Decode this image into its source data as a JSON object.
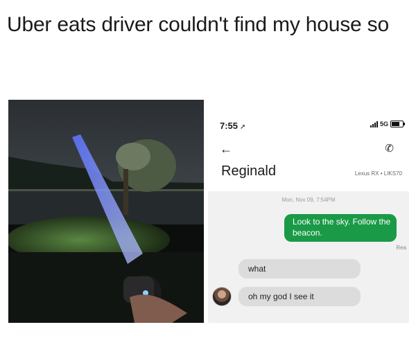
{
  "meme": {
    "caption": "Uber eats driver couldn't find my house so"
  },
  "photo": {
    "icon": "flashlight-beam-photo"
  },
  "phone": {
    "status": {
      "time": "7:55",
      "location_arrow": "➚",
      "network": "5G"
    },
    "header": {
      "back_icon": "←",
      "call_icon": "✆",
      "contact_name": "Reginald",
      "vehicle": "Lexus RX • LIKS70"
    },
    "thread": {
      "timestamp": "Mon, Nov 09, 7:54PM",
      "outgoing": [
        {
          "text": "Look to the sky. Follow the beacon."
        }
      ],
      "read_receipt": "Rea",
      "incoming": [
        {
          "text": "what"
        },
        {
          "text": "oh my god I see it"
        }
      ]
    },
    "colors": {
      "outgoing_bubble": "#1a9a47",
      "incoming_bubble": "#dcdcdc",
      "thread_background": "#f1f1f1"
    }
  }
}
